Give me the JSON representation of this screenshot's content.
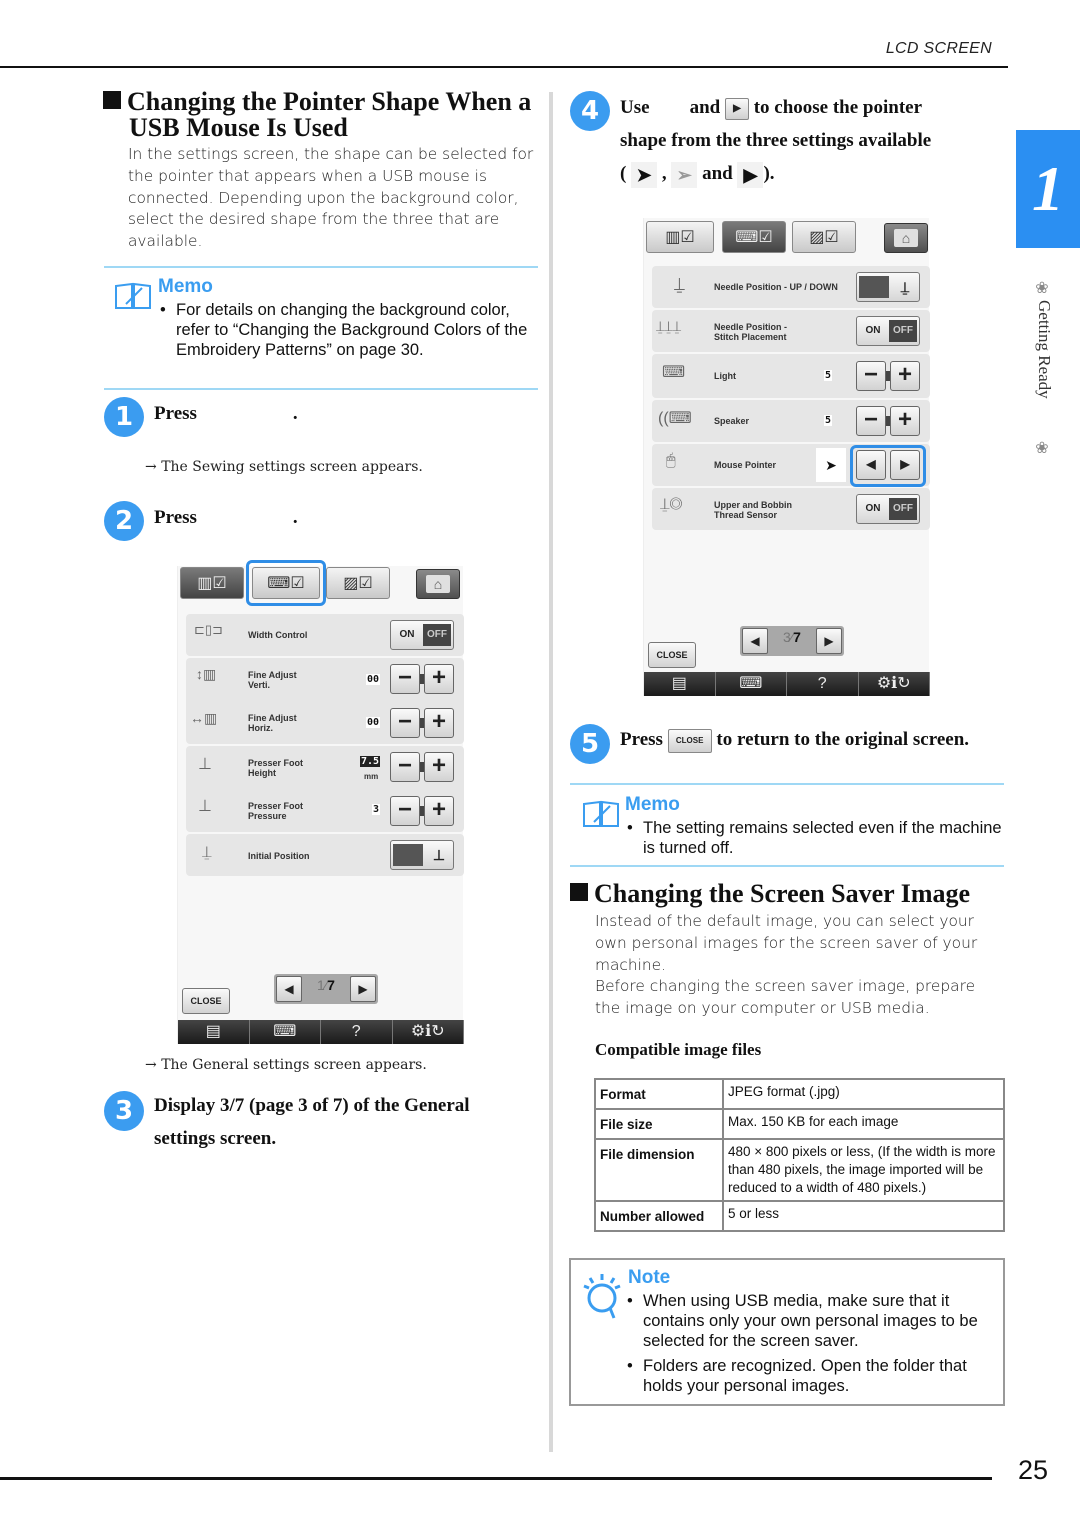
{
  "header": {
    "section": "LCD SCREEN"
  },
  "chapter": {
    "number": "1",
    "label": "Getting Ready",
    "tab_color": "#2b8ff2"
  },
  "page_number": "25",
  "left": {
    "heading": "Changing the Pointer Shape When a USB Mouse Is Used",
    "heading_line1": "Changing the Pointer Shape When a",
    "heading_line2": "USB Mouse Is Used",
    "intro": "In the settings screen, the shape can be selected for the pointer that appears when a USB mouse is connected. Depending upon the background color, select the desired shape from the three that are available.",
    "memo": {
      "title": "Memo",
      "items": [
        "For details on changing the background color, refer to “Changing the Background Colors of the Embroidery Patterns” on page 30."
      ]
    },
    "steps": [
      {
        "num": "1",
        "text": "Press",
        "suffix": ".",
        "result": "The Sewing settings screen appears."
      },
      {
        "num": "2",
        "text": "Press",
        "suffix": ".",
        "result": "The General settings screen appears."
      },
      {
        "num": "3",
        "text": "Display 3/7 (page 3 of 7) of the General settings screen."
      }
    ],
    "screen": {
      "tabs": [
        "sewing-settings-tab",
        "general-settings-tab",
        "embroidery-settings-tab",
        "home"
      ],
      "selected_tab": "general-settings-tab",
      "rows": [
        {
          "label": "Width Control",
          "control": "on-off",
          "on": "ON",
          "off": "OFF",
          "state": "OFF"
        },
        {
          "label": "Fine Adjust Verti.",
          "line1": "Fine Adjust",
          "line2": "Verti.",
          "value": "00",
          "control": "plus-minus"
        },
        {
          "label": "Fine Adjust Horiz.",
          "line1": "Fine Adjust",
          "line2": "Horiz.",
          "value": "00",
          "control": "plus-minus"
        },
        {
          "label": "Presser Foot Height",
          "line1": "Presser Foot",
          "line2": "Height",
          "value": "7.5",
          "unit": "mm",
          "control": "plus-minus"
        },
        {
          "label": "Presser Foot Pressure",
          "line1": "Presser Foot",
          "line2": "Pressure",
          "value": "3",
          "control": "plus-minus"
        },
        {
          "label": "Initial Position",
          "control": "toggle-icons"
        }
      ],
      "page": {
        "current": "1",
        "total": "7"
      },
      "close_label": "CLOSE",
      "bottom_bar": [
        "document-icon",
        "sewing-machine-icon",
        "?",
        "settings-info-icon"
      ]
    }
  },
  "right": {
    "step4": {
      "num": "4",
      "line1_a": "Use",
      "line1_b": "and",
      "line1_c": "to choose the pointer",
      "line2": "shape from the three settings available",
      "line3_open": "(",
      "line3_sep": ",",
      "line3_and": "and",
      "line3_close": ")."
    },
    "screen": {
      "tabs": [
        "sewing-settings-tab",
        "general-settings-tab",
        "embroidery-settings-tab",
        "home"
      ],
      "selected_tab": "general-settings-tab",
      "rows": [
        {
          "label": "Needle Position - UP / DOWN",
          "control": "toggle-icons"
        },
        {
          "label": "Needle Position - Stitch Placement",
          "line1": "Needle Position -",
          "line2": "Stitch Placement",
          "control": "on-off",
          "on": "ON",
          "off": "OFF",
          "state": "OFF"
        },
        {
          "label": "Light",
          "value": "5",
          "control": "plus-minus"
        },
        {
          "label": "Speaker",
          "value": "5",
          "control": "plus-minus"
        },
        {
          "label": "Mouse Pointer",
          "value": "arrow-pointer",
          "control": "left-right"
        },
        {
          "label": "Upper and Bobbin Thread Sensor",
          "line1": "Upper and Bobbin",
          "line2": "Thread Sensor",
          "control": "on-off",
          "on": "ON",
          "off": "OFF",
          "state": "OFF"
        }
      ],
      "page": {
        "current": "3",
        "total": "7"
      },
      "close_label": "CLOSE",
      "bottom_bar": [
        "document-icon",
        "sewing-machine-icon",
        "?",
        "settings-info-icon"
      ]
    },
    "step5": {
      "num": "5",
      "a": "Press",
      "btn": "CLOSE",
      "b": "to return to the original screen."
    },
    "memo": {
      "title": "Memo",
      "items": [
        "The setting remains selected even if the machine is turned off."
      ]
    },
    "heading": "Changing the Screen Saver Image",
    "intro1": "Instead of the default image, you can select your own personal images for the screen saver of your machine.",
    "intro2": "Before changing the screen saver image, prepare the image on your computer or USB media.",
    "table_title": "Compatible image files",
    "table": [
      {
        "key": "Format",
        "value": "JPEG format (.jpg)"
      },
      {
        "key": "File size",
        "value": "Max. 150 KB for each image"
      },
      {
        "key": "File dimension",
        "value": "480 × 800 pixels or less, (If the width is more than 480 pixels, the image imported will be reduced to a width of 480 pixels.)"
      },
      {
        "key": "Number allowed",
        "value": "5 or less"
      }
    ],
    "note": {
      "title": "Note",
      "items": [
        "When using USB media, make sure that it contains only your own personal images to be selected for the screen saver.",
        "Folders are recognized. Open the folder that holds your personal images."
      ]
    }
  },
  "glyphs": {
    "arrow": "→",
    "bullet": "•",
    "left": "◀",
    "right": "▶",
    "minus": "−",
    "plus": "+",
    "ptr_black": "⬉",
    "ptr_white": "⇖",
    "ptr_tri": "◥",
    "home": "⌂",
    "ornament": "❀"
  }
}
